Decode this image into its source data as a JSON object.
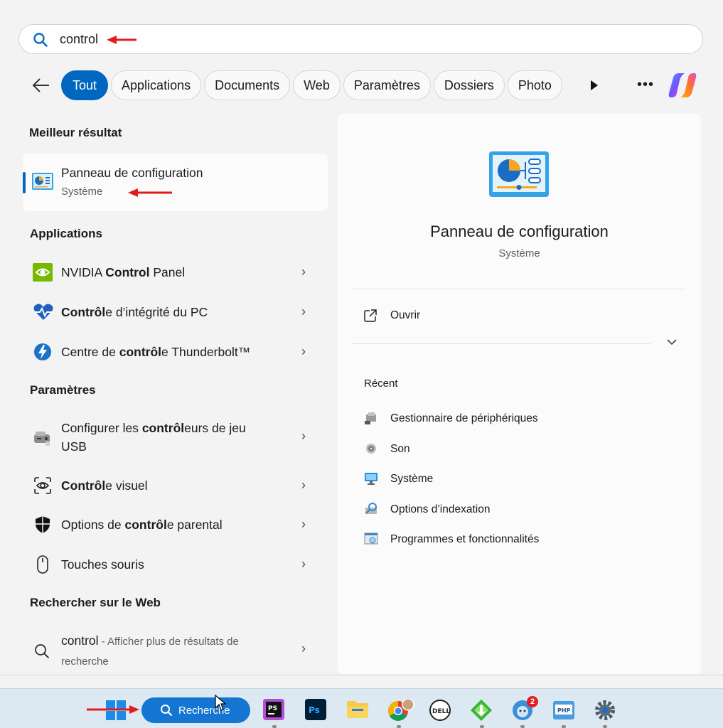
{
  "search": {
    "query": "control"
  },
  "filters": {
    "chips": [
      "Tout",
      "Applications",
      "Documents",
      "Web",
      "Paramètres",
      "Dossiers",
      "Photo"
    ],
    "active_index": 0
  },
  "best_match": {
    "heading": "Meilleur résultat",
    "title": "Panneau de configuration",
    "subtitle": "Système"
  },
  "applications": {
    "heading": "Applications",
    "items": [
      {
        "pre": "NVIDIA ",
        "bold": "Control",
        "post": " Panel",
        "icon": "nvidia-icon"
      },
      {
        "pre": "",
        "bold": "Contrôl",
        "post": "e d’intégrité du PC",
        "icon": "health-heart-icon"
      },
      {
        "pre": "Centre de ",
        "bold": "contrôl",
        "post": "e Thunderbolt™",
        "icon": "thunderbolt-icon"
      }
    ]
  },
  "settings": {
    "heading": "Paramètres",
    "items": [
      {
        "pre": "Configurer les ",
        "bold": "contrôl",
        "post": "eurs de jeu",
        "line2": "USB",
        "icon": "game-controller-icon"
      },
      {
        "pre": "",
        "bold": "Contrôl",
        "post": "e visuel",
        "icon": "eye-scan-icon"
      },
      {
        "pre": "Options de ",
        "bold": "contrôl",
        "post": "e parental",
        "icon": "shield-icon"
      },
      {
        "pre": "Touches souris",
        "bold": "",
        "post": "",
        "icon": "mouse-icon"
      }
    ]
  },
  "web": {
    "heading": "Rechercher sur le Web",
    "query": "control",
    "sub1": " - Afficher plus de résultats de",
    "sub2": "recherche"
  },
  "preview": {
    "title": "Panneau de configuration",
    "subtitle": "Système",
    "open_label": "Ouvrir",
    "recent_heading": "Récent",
    "recent": [
      {
        "label": "Gestionnaire de périphériques",
        "icon": "device-manager-icon"
      },
      {
        "label": "Son",
        "icon": "sound-icon"
      },
      {
        "label": "Système",
        "icon": "system-monitor-icon"
      },
      {
        "label": "Options d’indexation",
        "icon": "indexing-icon"
      },
      {
        "label": "Programmes et fonctionnalités",
        "icon": "programs-icon"
      }
    ]
  },
  "taskbar": {
    "search_label": "Recherche",
    "notification_count": "2"
  },
  "colors": {
    "accent": "#0067c0",
    "arrow": "#e21b1b",
    "taskbar_search": "#1476d2"
  }
}
